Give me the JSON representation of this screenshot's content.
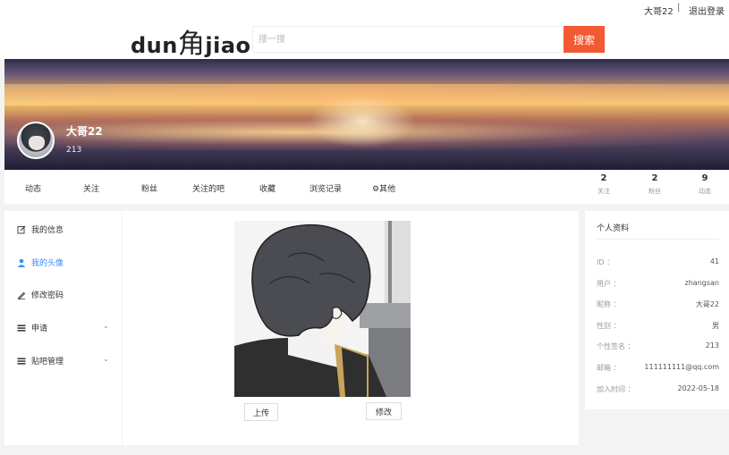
{
  "topbar": {
    "username": "大哥22",
    "separator": "|",
    "logout": "退出登录"
  },
  "header": {
    "logo_pre": "dun",
    "logo_char": "角",
    "logo_post": "jiao",
    "search_placeholder": "搜一搜",
    "search_button": "搜索"
  },
  "profile": {
    "name": "大哥22",
    "signature": "213"
  },
  "nav": {
    "tabs": [
      "动态",
      "关注",
      "粉丝",
      "关注的吧",
      "收藏",
      "浏览记录",
      "⚙其他"
    ],
    "stats": [
      {
        "num": "2",
        "label": "关注"
      },
      {
        "num": "2",
        "label": "粉丝"
      },
      {
        "num": "9",
        "label": "动态"
      }
    ]
  },
  "menu": {
    "items": [
      "我的信息",
      "我的头像",
      "修改密码",
      "申请",
      "贴吧管理"
    ],
    "active_color": "#3b8bff"
  },
  "avatar_panel": {
    "upload": "上传",
    "edit": "修改"
  },
  "info": {
    "title": "个人资料",
    "rows": [
      {
        "label": "ID ：",
        "value": "41"
      },
      {
        "label": "用户 ：",
        "value": "zhangsan"
      },
      {
        "label": "昵称 ：",
        "value": "大哥22"
      },
      {
        "label": "性别 ：",
        "value": "男"
      },
      {
        "label": "个性签名 ：",
        "value": "213"
      },
      {
        "label": "邮箱 ：",
        "value": "111111111@qq.com"
      },
      {
        "label": "加入时间 ：",
        "value": "2022-05-18"
      }
    ]
  },
  "colors": {
    "accent": "#f15a32",
    "link": "#3b8bff"
  }
}
